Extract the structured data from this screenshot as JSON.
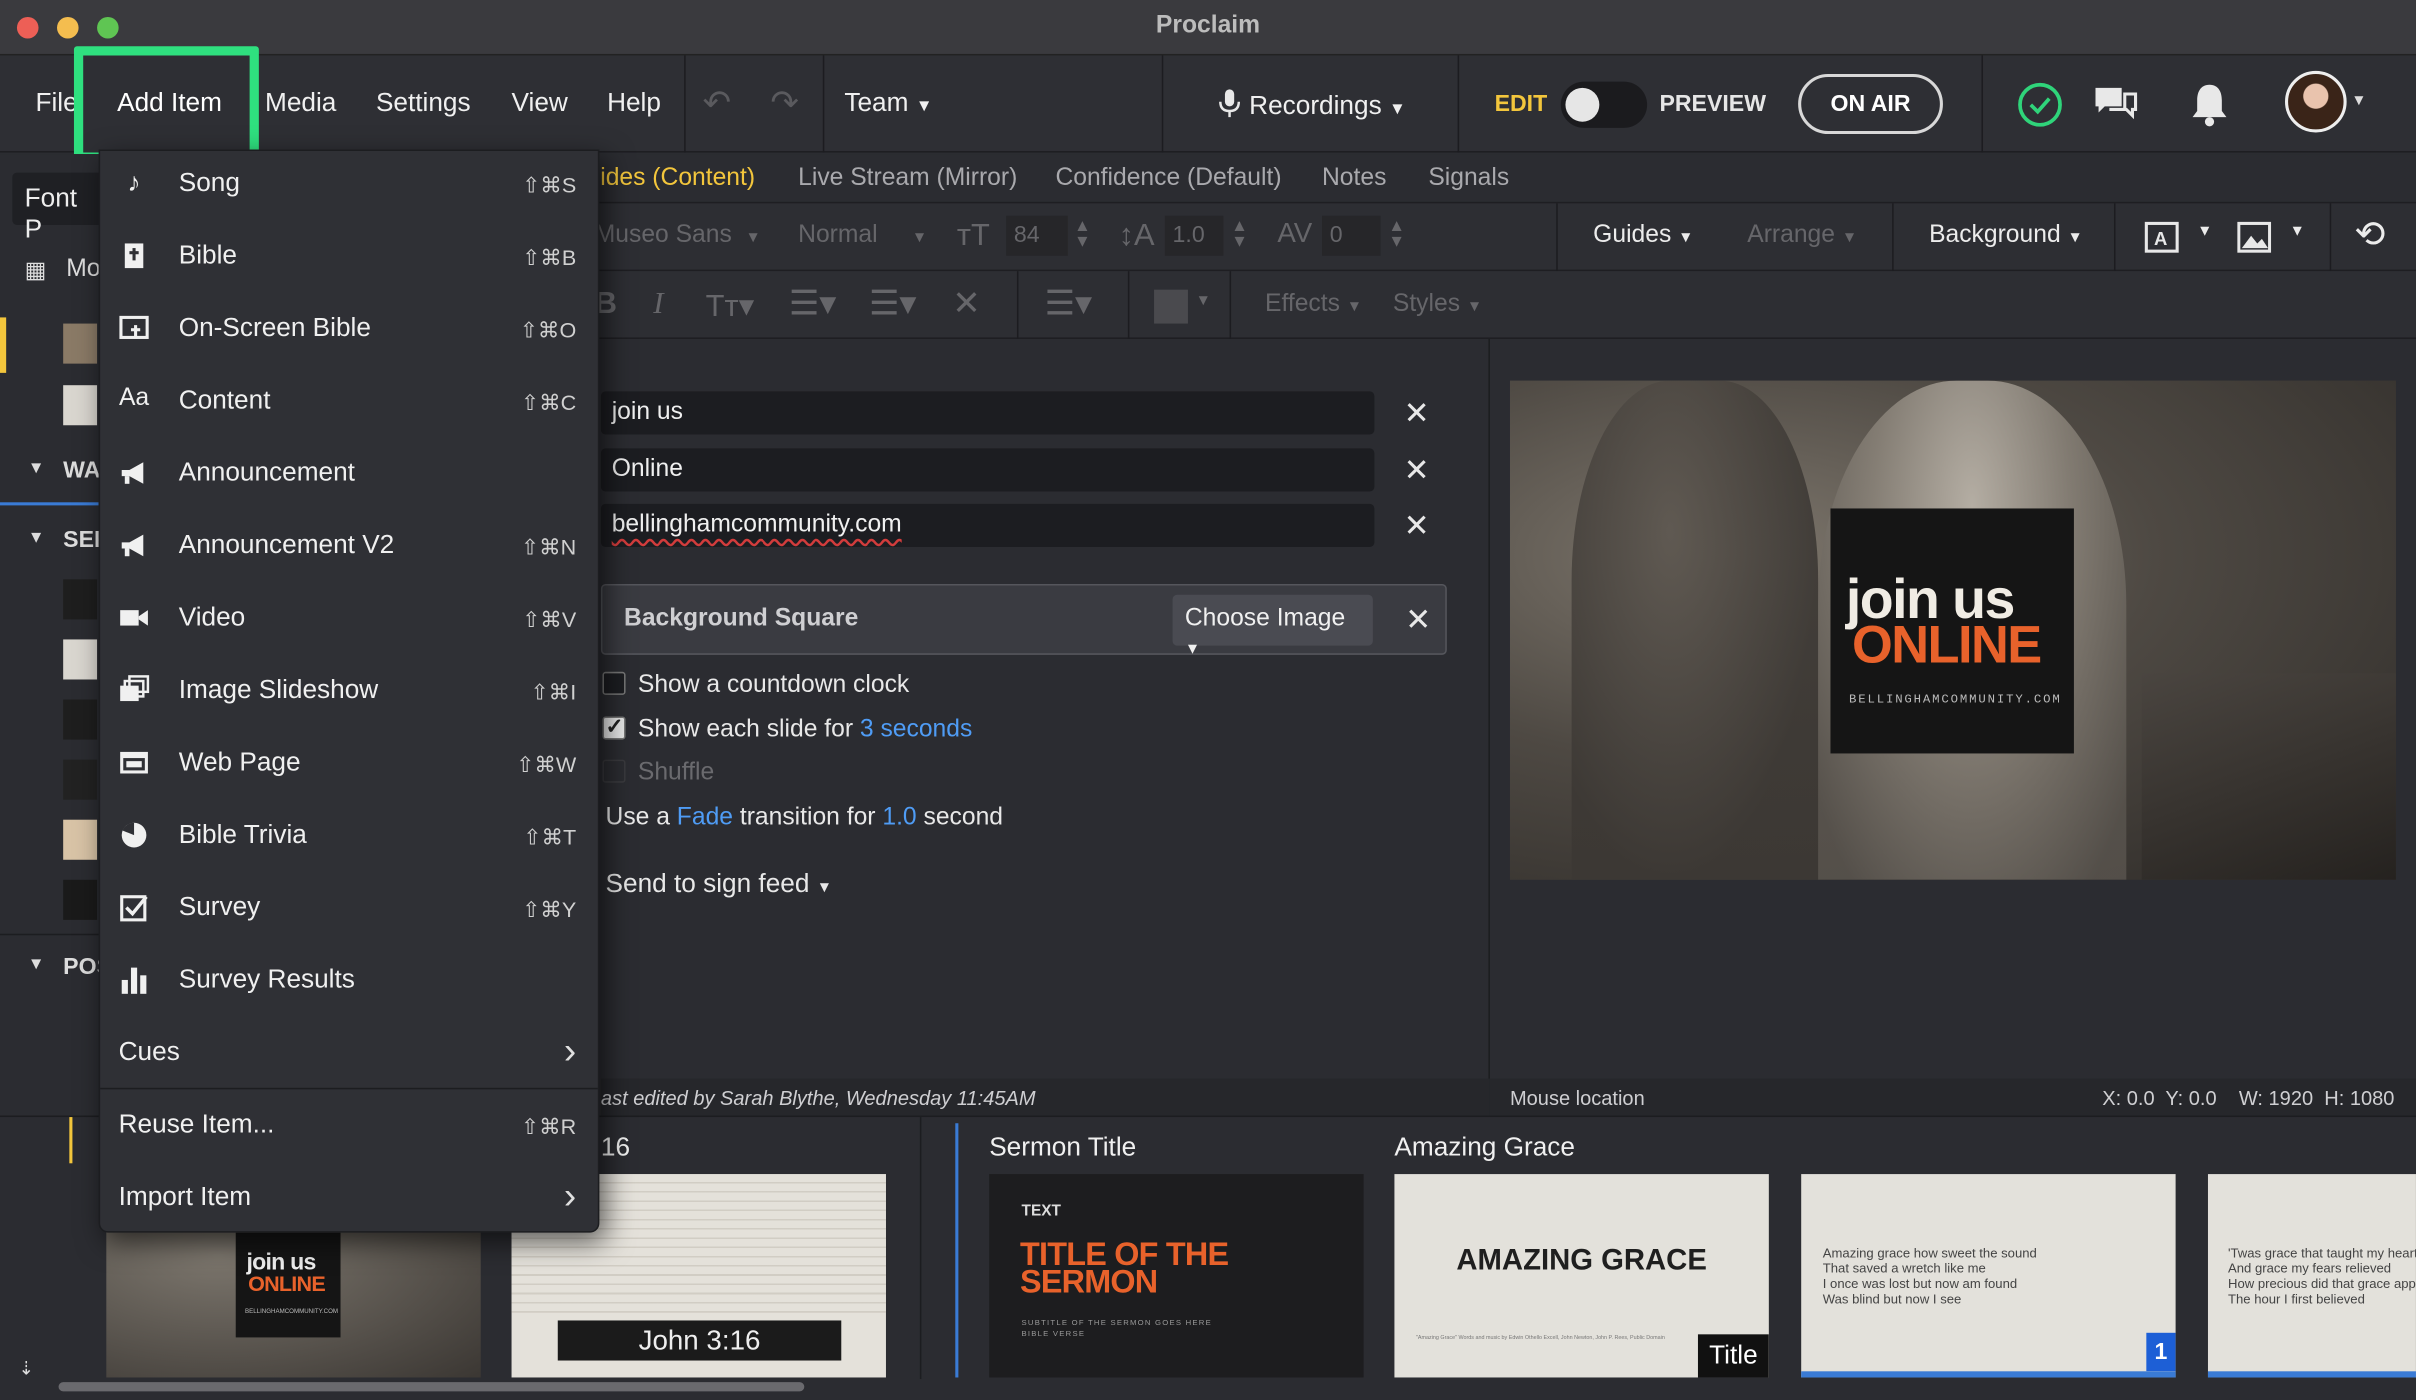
{
  "app": {
    "title": "Proclaim"
  },
  "menubar": {
    "file": "File",
    "add_item": "Add Item",
    "media": "Media",
    "settings": "Settings",
    "view": "View",
    "help": "Help",
    "team": "Team",
    "recordings": "Recordings",
    "edit": "EDIT",
    "preview": "PREVIEW",
    "on_air": "ON AIR"
  },
  "tabs": [
    {
      "label": "lides (Content)",
      "active": true
    },
    {
      "label": "Live Stream (Mirror)",
      "active": false
    },
    {
      "label": "Confidence (Default)",
      "active": false
    },
    {
      "label": "Notes",
      "active": false
    },
    {
      "label": "Signals",
      "active": false
    }
  ],
  "format": {
    "font": "Museo Sans",
    "weight": "Normal",
    "size": "84",
    "line_height": "1.0",
    "spacing": "0",
    "guides": "Guides",
    "arrange": "Arrange",
    "background": "Background",
    "effects": "Effects",
    "styles": "Styles"
  },
  "sidebar": {
    "font_label": "Font P",
    "mo_label": "Mo",
    "wa_label": "WA",
    "ser_label": "SER",
    "pos_label": "POS"
  },
  "editor": {
    "fields": [
      "join us",
      "Online",
      "bellinghamcommunity.com"
    ],
    "background_square": "Background Square",
    "choose_image": "Choose Image",
    "countdown": "Show a countdown clock",
    "show_each_prefix": "Show each slide for",
    "show_each_value": "3 seconds",
    "shuffle": "Shuffle",
    "transition_use": "Use a",
    "transition_type": "Fade",
    "transition_for": "transition for",
    "transition_value": "1.0",
    "transition_unit": "second",
    "send_to_sign": "Send to sign feed",
    "status": "ast edited by Sarah Blythe, Wednesday 11:45AM"
  },
  "preview": {
    "join": "join us",
    "online": "ONLINE",
    "url": "BELLINGHAMCOMMUNITY.COM"
  },
  "mouse": {
    "label": "Mouse location",
    "coords": "X: 0.0  Y: 0.0    W: 1920  H: 1080"
  },
  "strip": {
    "group1_title": "16",
    "group2_title": "Sermon Title",
    "group3_title": "Amazing Grace",
    "thumb_join": "join us",
    "thumb_online": "ONLINE",
    "thumb_url": "BELLINGHAMCOMMUNITY.COM",
    "verse_ref": "John 3:16",
    "sermon_text_label": "TEXT",
    "sermon_title": "TITLE OF THE SERMON",
    "sermon_sub": "SUBTITLE OF THE SERMON GOES HERE",
    "sermon_sub2": "BIBLE VERSE",
    "amazing_title": "AMAZING GRACE",
    "amazing_credit": "\"Amazing Grace\" Words and music by Edwin Othello Excell, John Newton, John P. Rees, Public Domain",
    "title_badge": "Title",
    "lyric1": "Amazing grace how sweet the sound\nThat saved a wretch like me\nI once was lost but now am found\nWas blind but now I see",
    "lyric_badge": "1",
    "lyric2": "'Twas grace that taught my heart t\nAnd grace my fears relieved\nHow precious did that grace appe\nThe hour I first believed"
  },
  "menu": {
    "items": [
      {
        "label": "Song",
        "shortcut": "⇧⌘S",
        "icon": "music-note-icon"
      },
      {
        "label": "Bible",
        "shortcut": "⇧⌘B",
        "icon": "bible-icon"
      },
      {
        "label": "On-Screen Bible",
        "shortcut": "⇧⌘O",
        "icon": "on-screen-bible-icon"
      },
      {
        "label": "Content",
        "shortcut": "⇧⌘C",
        "icon": "content-aa-icon"
      },
      {
        "label": "Announcement",
        "shortcut": "",
        "icon": "megaphone-icon"
      },
      {
        "label": "Announcement V2",
        "shortcut": "⇧⌘N",
        "icon": "megaphone-icon"
      },
      {
        "label": "Video",
        "shortcut": "⇧⌘V",
        "icon": "video-camera-icon"
      },
      {
        "label": "Image Slideshow",
        "shortcut": "⇧⌘I",
        "icon": "slideshow-icon"
      },
      {
        "label": "Web Page",
        "shortcut": "⇧⌘W",
        "icon": "web-page-icon"
      },
      {
        "label": "Bible Trivia",
        "shortcut": "⇧⌘T",
        "icon": "pie-chart-icon"
      },
      {
        "label": "Survey",
        "shortcut": "⇧⌘Y",
        "icon": "checkbox-icon"
      },
      {
        "label": "Survey Results",
        "shortcut": "",
        "icon": "bar-chart-icon"
      },
      {
        "label": "Cues",
        "shortcut": "",
        "icon": ""
      }
    ],
    "reuse": {
      "label": "Reuse Item...",
      "shortcut": "⇧⌘R"
    },
    "import": {
      "label": "Import Item"
    }
  },
  "colors": {
    "accent_yellow": "#f3c63c",
    "highlight_green": "#2fe07f",
    "link_blue": "#4f9cf5",
    "online_orange": "#e8622b"
  }
}
